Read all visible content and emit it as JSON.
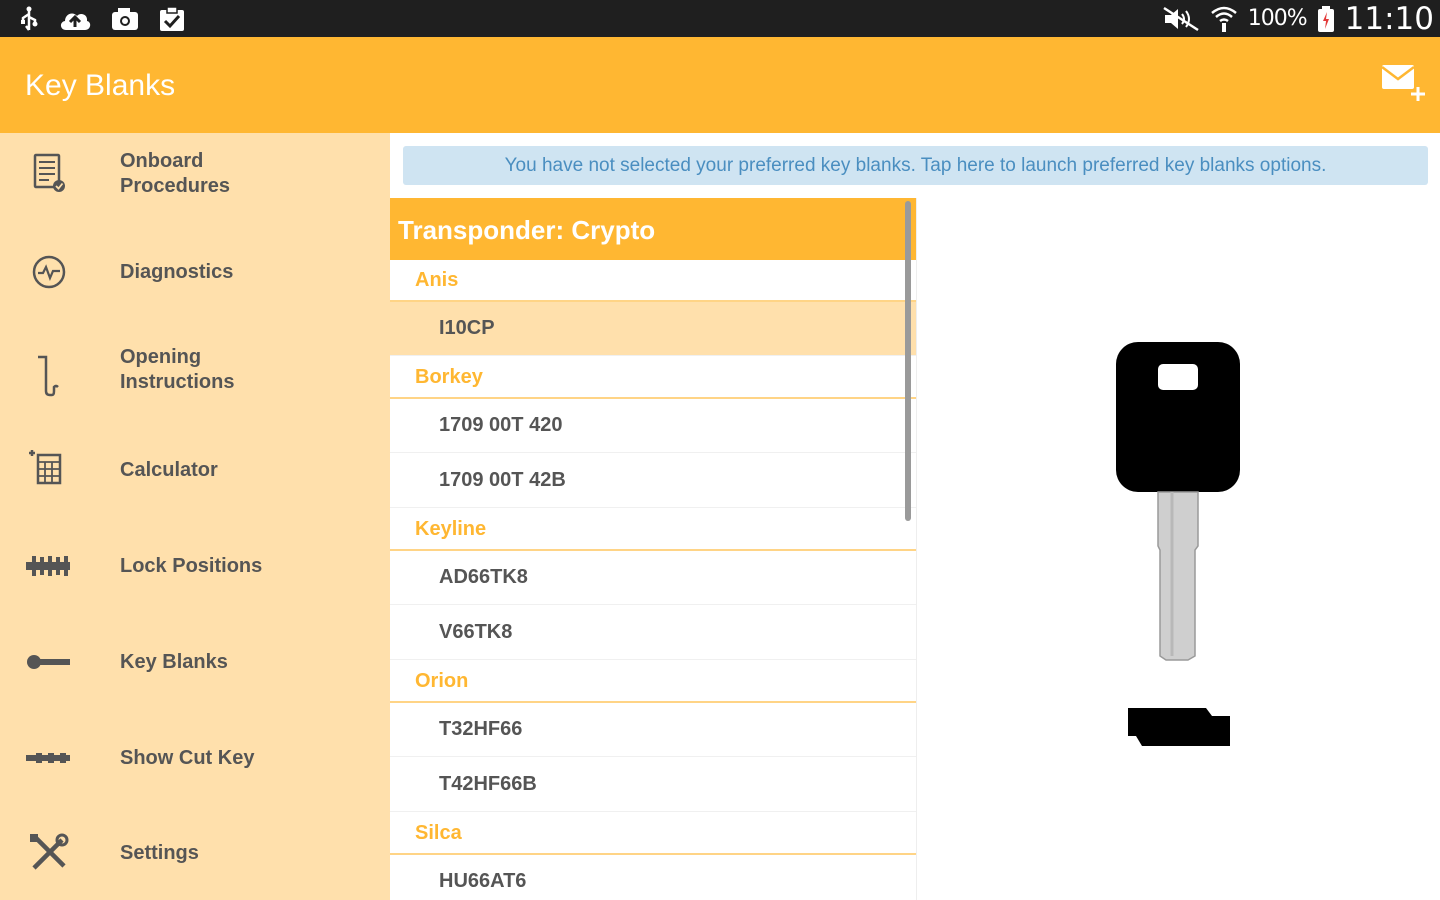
{
  "status_bar": {
    "left_icons": [
      "usb-icon",
      "cloud-upload-icon",
      "camera-icon",
      "clipboard-check-icon"
    ],
    "right_icons": [
      "mute-icon",
      "wifi-icon",
      "battery-icon"
    ],
    "battery_text": "100%",
    "clock": "11:10"
  },
  "app_bar": {
    "title": "Key Blanks",
    "action_icon": "compose-email-icon"
  },
  "colors": {
    "accent": "#ffb732",
    "sidebar_bg": "#ffe0ac",
    "banner_bg": "#cfe4f2",
    "banner_text": "#4a8ec0",
    "group_text": "#ffb732",
    "item_text": "#555555"
  },
  "sidebar": {
    "items": [
      {
        "label": "Onboard\nProcedures",
        "icon": "document-check-icon"
      },
      {
        "label": "Diagnostics",
        "icon": "gauge-icon"
      },
      {
        "label": "Opening\nInstructions",
        "icon": "pick-tool-icon"
      },
      {
        "label": "Calculator",
        "icon": "calculator-icon"
      },
      {
        "label": "Lock Positions",
        "icon": "lock-positions-icon"
      },
      {
        "label": "Key Blanks",
        "icon": "key-icon"
      },
      {
        "label": "Show Cut Key",
        "icon": "cut-key-icon"
      },
      {
        "label": "Settings",
        "icon": "tools-icon"
      }
    ]
  },
  "banner": {
    "text": "You have not selected your preferred key blanks. Tap here to launch preferred key blanks options."
  },
  "list": {
    "header": "Transponder: Crypto",
    "groups": [
      {
        "name": "Anis",
        "items": [
          "I10CP"
        ]
      },
      {
        "name": "Borkey",
        "items": [
          "1709 00T 420",
          "1709 00T 42B"
        ]
      },
      {
        "name": "Keyline",
        "items": [
          "AD66TK8",
          "V66TK8"
        ]
      },
      {
        "name": "Orion",
        "items": [
          "T32HF66",
          "T42HF66B"
        ]
      },
      {
        "name": "Silca",
        "items": [
          "HU66AT6"
        ]
      }
    ],
    "selected_item": "I10CP"
  },
  "preview": {
    "image": "key-blank-image"
  }
}
